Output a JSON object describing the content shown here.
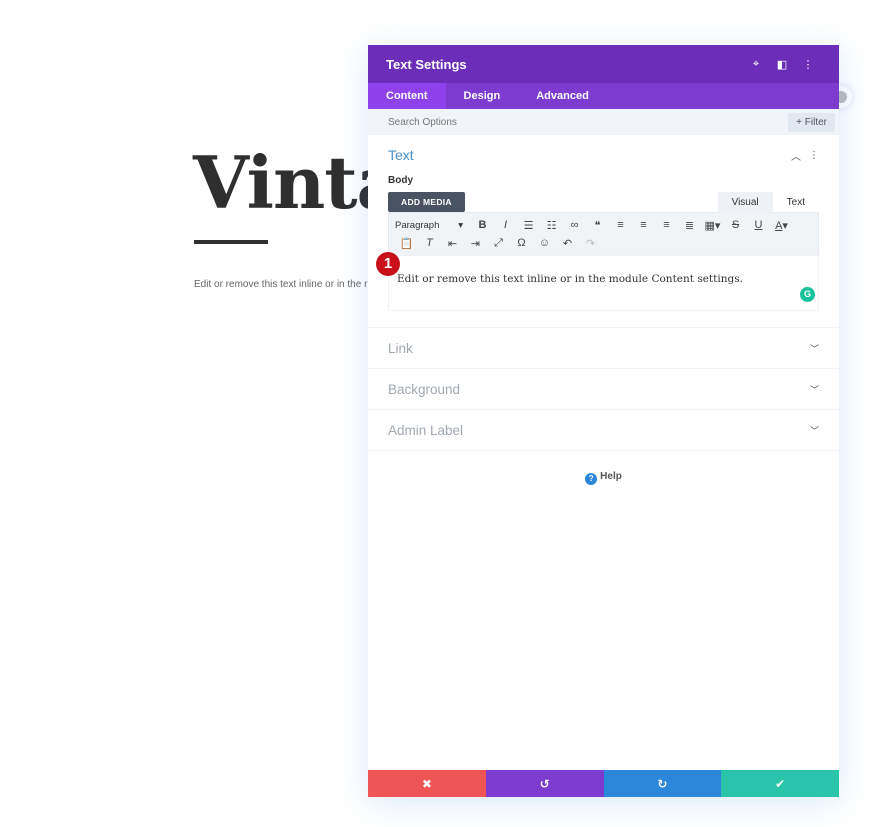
{
  "background": {
    "heading": "Vinta",
    "body_text": "Edit or remove this text inline or in the r"
  },
  "modal": {
    "title": "Text Settings",
    "header_icons": [
      "focus-icon",
      "split-view-icon",
      "more-vertical-icon"
    ],
    "tabs": [
      {
        "label": "Content",
        "active": true
      },
      {
        "label": "Design",
        "active": false
      },
      {
        "label": "Advanced",
        "active": false
      }
    ],
    "search": {
      "placeholder": "Search Options",
      "filter_label": "+ Filter"
    },
    "text_section": {
      "title": "Text",
      "body_label": "Body",
      "add_media_label": "ADD MEDIA",
      "mode_tabs": [
        {
          "label": "Visual",
          "active": true
        },
        {
          "label": "Text",
          "active": false
        }
      ],
      "format_select": "Paragraph",
      "toolbar_row1": [
        "B",
        "I",
        "☰",
        "☷",
        "🔗",
        "❝",
        "≡",
        "≡",
        "≡",
        "≡",
        "▦▾",
        "S",
        "U",
        "A▾"
      ],
      "toolbar_row2": [
        "📋",
        "Tx",
        "⇤",
        "⇥",
        "⤢",
        "Ω",
        "☺",
        "↶",
        "↷"
      ],
      "content": "Edit or remove this text inline or in the module Content settings.",
      "step_badge": "1"
    },
    "collapsed_sections": [
      "Link",
      "Background",
      "Admin Label"
    ],
    "help_label": "Help",
    "footer": {
      "cancel": "✖",
      "undo": "↺",
      "redo": "↻",
      "save": "✔"
    },
    "colors": {
      "header": "#6c2eb9",
      "tabs": "#7e3bd0",
      "cancel": "#ef5555",
      "undo": "#7e3bd0",
      "redo": "#2b87da",
      "save": "#29c4a9"
    }
  }
}
